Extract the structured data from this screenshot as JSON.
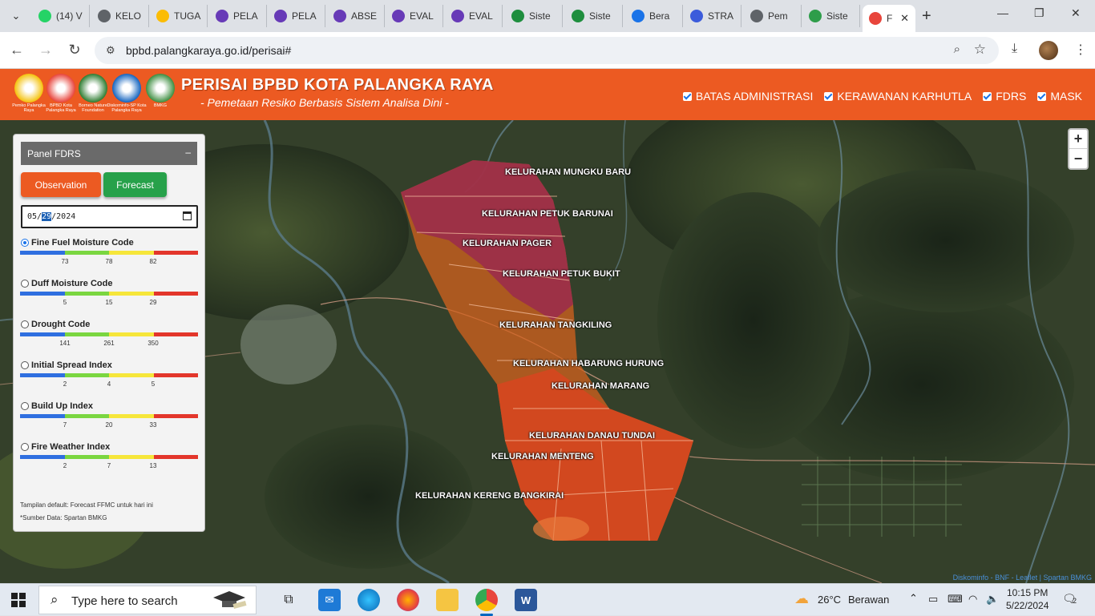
{
  "browser": {
    "tabs": [
      {
        "title": "(14) WhatsApp",
        "short": "(14) V",
        "icon": "whatsapp-icon",
        "color": "#25d366"
      },
      {
        "title": "KELOMPOK",
        "short": "KELO",
        "icon": "globe-icon",
        "color": "#5f6368"
      },
      {
        "title": "TUGAS",
        "short": "TUGA",
        "icon": "drive-icon",
        "color": "#fbbc04"
      },
      {
        "title": "PELATIHAN",
        "short": "PELA",
        "icon": "forms-icon",
        "color": "#673ab7"
      },
      {
        "title": "PELATIHAN",
        "short": "PELA",
        "icon": "forms-icon",
        "color": "#673ab7"
      },
      {
        "title": "ABSEN",
        "short": "ABSE",
        "icon": "forms-icon",
        "color": "#673ab7"
      },
      {
        "title": "EVALUASI",
        "short": "EVAL",
        "icon": "forms-icon",
        "color": "#673ab7"
      },
      {
        "title": "EVALUASI",
        "short": "EVAL",
        "icon": "forms-icon",
        "color": "#673ab7"
      },
      {
        "title": "Sistem",
        "short": "Siste",
        "icon": "sites-icon",
        "color": "#1e8e3e"
      },
      {
        "title": "Sistem",
        "short": "Siste",
        "icon": "sites-icon",
        "color": "#1e8e3e"
      },
      {
        "title": "Beranda",
        "short": "Bera",
        "icon": "c-icon",
        "color": "#1a73e8"
      },
      {
        "title": "STRATEGI",
        "short": "STRA",
        "icon": "chat-icon",
        "color": "#3b5bdb"
      },
      {
        "title": "Pemetaan",
        "short": "Pem",
        "icon": "globe-icon",
        "color": "#5f6368"
      },
      {
        "title": "Sistem",
        "short": "Siste",
        "icon": "bmkg-icon",
        "color": "#2e9d4a"
      },
      {
        "title": "PERISAI",
        "short": "F",
        "icon": "bpbd-icon",
        "color": "#e8453c",
        "active": true
      }
    ],
    "url": "bpbd.palangkaraya.go.id/perisai#"
  },
  "header": {
    "logos": [
      {
        "name": "pemko-logo",
        "caption": "Pemko Palangka Raya",
        "color": "#f4c20d"
      },
      {
        "name": "bpbd-logo",
        "caption": "BPBD Kota Palangka Raya",
        "color": "#e8453c"
      },
      {
        "name": "bnf-logo",
        "caption": "Borneo Nature Foundation",
        "color": "#2f7d32"
      },
      {
        "name": "diskominfo-logo",
        "caption": "Diskominfo-SP Kota Palangka Raya",
        "color": "#1565c0"
      },
      {
        "name": "bmkg-logo",
        "caption": "BMKG",
        "color": "#3e8e41"
      }
    ],
    "title": "PERISAI BPBD KOTA PALANGKA RAYA",
    "subtitle": "- Pemetaan Resiko Berbasis Sistem Analisa Dini -",
    "layers": [
      {
        "label": "BATAS ADMINISTRASI",
        "checked": true
      },
      {
        "label": "KERAWANAN KARHUTLA",
        "checked": true
      },
      {
        "label": "FDRS",
        "checked": true
      },
      {
        "label": "MASK",
        "checked": true
      }
    ]
  },
  "panel": {
    "title": "Panel FDRS",
    "collapse": "–",
    "observation_label": "Observation",
    "forecast_label": "Forecast",
    "date": {
      "month": "05",
      "day": "29",
      "year": "2024"
    },
    "indices": [
      {
        "name": "Fine Fuel Moisture Code",
        "selected": true,
        "ticks": [
          "73",
          "78",
          "82"
        ]
      },
      {
        "name": "Duff Moisture Code",
        "selected": false,
        "ticks": [
          "5",
          "15",
          "29"
        ]
      },
      {
        "name": "Drought Code",
        "selected": false,
        "ticks": [
          "141",
          "261",
          "350"
        ]
      },
      {
        "name": "Initial Spread Index",
        "selected": false,
        "ticks": [
          "2",
          "4",
          "5"
        ]
      },
      {
        "name": "Build Up Index",
        "selected": false,
        "ticks": [
          "7",
          "20",
          "33"
        ]
      },
      {
        "name": "Fire Weather Index",
        "selected": false,
        "ticks": [
          "2",
          "7",
          "13"
        ]
      }
    ],
    "scale_colors": [
      "#2f6fe0",
      "#7ad640",
      "#f6e63a",
      "#e3362b"
    ],
    "note_default": "Tampilan default: Forecast FFMC untuk hari ini",
    "note_source": "*Sumber Data: Spartan BMKG"
  },
  "map": {
    "kelurahan": [
      "KELURAHAN MUNGKU BARU",
      "KELURAHAN PETUK BARUNAI",
      "KELURAHAN PAGER",
      "KELURAHAN PETUK BUKIT",
      "KELURAHAN TANGKILING",
      "KELURAHAN HABARUNG HURUNG",
      "KELURAHAN MARANG",
      "KELURAHAN DANAU TUNDAI",
      "KELURAHAN MENTENG",
      "KELURAHAN KERENG BANGKIRAI"
    ],
    "zoom_in": "+",
    "zoom_out": "−",
    "attribution": "Diskominfo - BNF - Leaflet | Spartan BMKG",
    "region_colors": {
      "north": "#9a2a4e",
      "south": "#d84520",
      "fill": "#d4621e"
    }
  },
  "taskbar": {
    "search_placeholder": "Type here to search",
    "weather_temp": "26°C",
    "weather_desc": "Berawan",
    "time": "10:15 PM",
    "date": "5/22/2024",
    "notifications": "2"
  }
}
